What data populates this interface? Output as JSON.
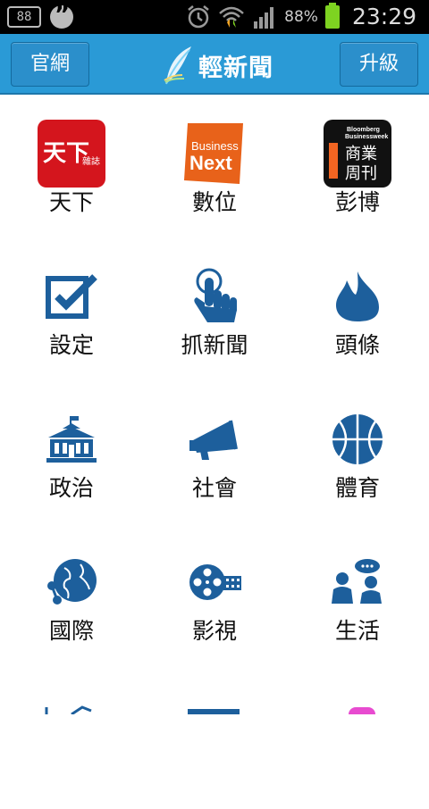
{
  "status_bar": {
    "notification_count": "88",
    "battery_percent": "88%",
    "time": "23:29",
    "icons": [
      "notification-badge-icon",
      "hangouts-icon",
      "alarm-icon",
      "wifi-icon",
      "signal-icon",
      "battery-icon"
    ]
  },
  "app_bar": {
    "left_button": "官網",
    "title": "輕新聞",
    "right_button": "升級",
    "colors": {
      "bar": "#2a9ad6",
      "button": "#2b8fcb"
    }
  },
  "grid": {
    "items": [
      {
        "label": "天下",
        "icon": "commonwealth-magazine-logo"
      },
      {
        "label": "數位",
        "icon": "business-next-logo"
      },
      {
        "label": "彭博",
        "icon": "bloomberg-businessweek-logo"
      },
      {
        "label": "設定",
        "icon": "checkbox-icon"
      },
      {
        "label": "抓新聞",
        "icon": "tap-hand-icon"
      },
      {
        "label": "頭條",
        "icon": "flame-icon"
      },
      {
        "label": "政治",
        "icon": "government-building-icon"
      },
      {
        "label": "社會",
        "icon": "megaphone-icon"
      },
      {
        "label": "體育",
        "icon": "basketball-icon"
      },
      {
        "label": "國際",
        "icon": "globe-icon"
      },
      {
        "label": "影視",
        "icon": "film-reel-icon"
      },
      {
        "label": "生活",
        "icon": "people-chat-icon"
      }
    ],
    "logos": {
      "tianxia": {
        "text": "天下",
        "sub": "雜誌"
      },
      "business_next": {
        "line1": "Business",
        "line2": "Next"
      },
      "bloomberg": {
        "line1": "Bloomberg",
        "line2": "Businessweek",
        "line3": "商業",
        "line4": "周刊"
      }
    },
    "icon_color": "#1d5f9c"
  }
}
